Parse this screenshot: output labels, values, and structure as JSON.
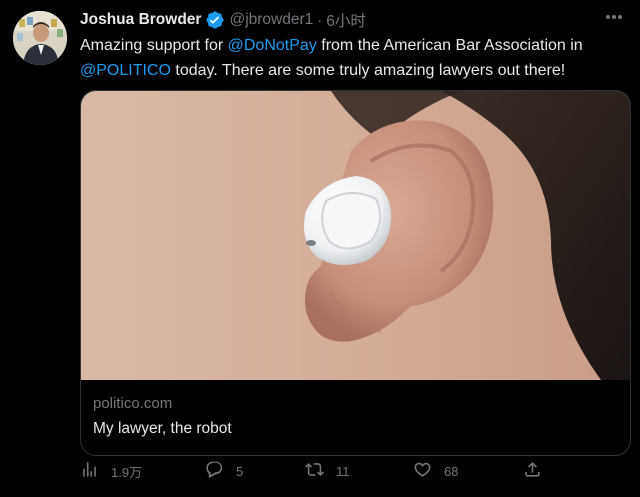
{
  "tweet": {
    "author": {
      "display_name": "Joshua Browder",
      "handle": "@jbrowder1",
      "separator": "·",
      "time": "6小时",
      "verified": true,
      "avatar_icon": "avatar-photo"
    },
    "text": {
      "part1": "Amazing support for ",
      "mention1": "@DoNotPay",
      "part2": " from the American Bar Association in ",
      "mention2": "@POLITICO",
      "part3": " today. There are some truly amazing lawyers out there!"
    },
    "card": {
      "domain": "politico.com",
      "title": "My lawyer, the robot",
      "image_icon": "earbud-in-ear-photo"
    },
    "actions": {
      "views": "1.9万",
      "replies": "5",
      "retweets": "11",
      "likes": "68"
    }
  },
  "colors": {
    "background": "#000000",
    "text": "#e7e9ea",
    "muted": "#71767b",
    "accent": "#1d9bf0",
    "border": "#2f3336"
  }
}
